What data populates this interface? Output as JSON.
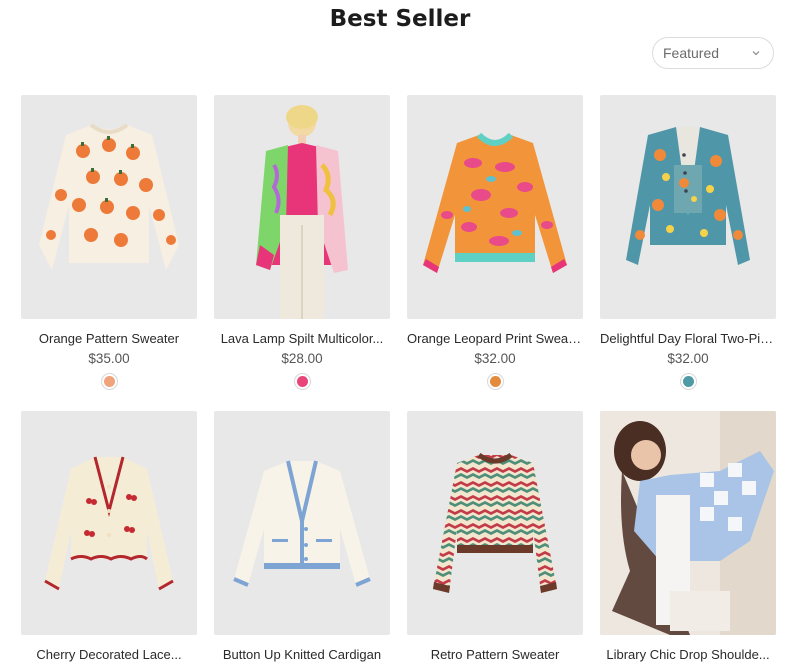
{
  "page": {
    "title": "Best Seller"
  },
  "sort": {
    "value": "Featured"
  },
  "products": [
    {
      "name": "Orange Pattern Sweater",
      "price": "$35.00",
      "swatch_color": "#f0a37a"
    },
    {
      "name": "Lava Lamp Spilt Multicolor...",
      "price": "$28.00",
      "swatch_color": "#e8457a"
    },
    {
      "name": "Orange Leopard Print Sweater",
      "price": "$32.00",
      "swatch_color": "#e48a3c"
    },
    {
      "name": "Delightful Day Floral Two-Pie...",
      "price": "$32.00",
      "swatch_color": "#4e9aa5"
    },
    {
      "name": "Cherry Decorated Lace..."
    },
    {
      "name": "Button Up Knitted Cardigan"
    },
    {
      "name": "Retro Pattern Sweater"
    },
    {
      "name": "Library Chic Drop Shoulde..."
    }
  ]
}
